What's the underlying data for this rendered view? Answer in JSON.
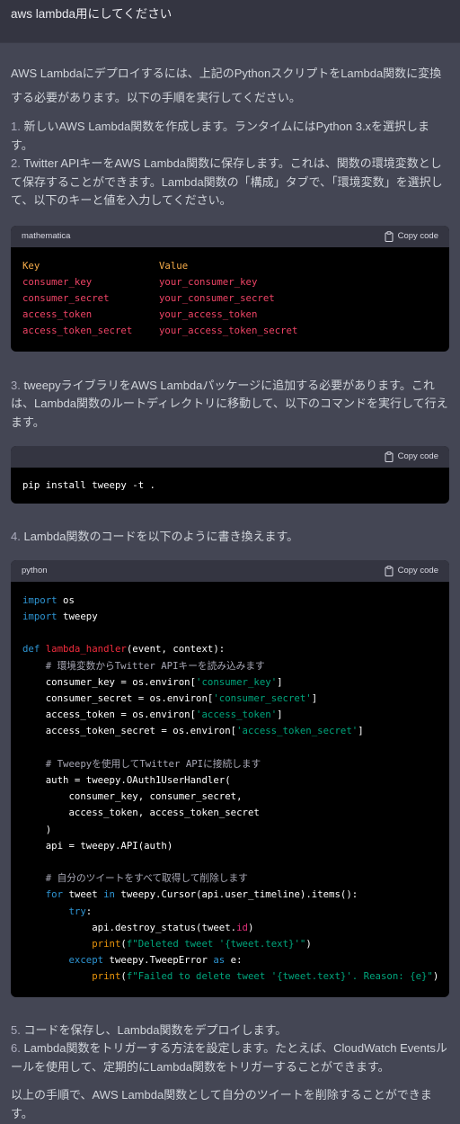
{
  "user": {
    "message": "aws lambda用にしてください"
  },
  "assistant": {
    "intro": "AWS Lambdaにデプロイするには、上記のPythonスクリプトをLambda関数に変換する必要があります。以下の手順を実行してください。",
    "steps_a": [
      {
        "num": "1.",
        "text": "新しいAWS Lambda関数を作成します。ランタイムにはPython 3.xを選択します。"
      },
      {
        "num": "2.",
        "text": "Twitter APIキーをAWS Lambda関数に保存します。これは、関数の環境変数として保存することができます。Lambda関数の「構成」タブで、「環境変数」を選択して、以下のキーと値を入力してください。"
      }
    ],
    "code1": {
      "language": "mathematica",
      "copy_label": "Copy code",
      "header": {
        "key": "Key",
        "value": "Value"
      },
      "rows": [
        {
          "key": "consumer_key",
          "value": "your_consumer_key"
        },
        {
          "key": "consumer_secret",
          "value": "your_consumer_secret"
        },
        {
          "key": "access_token",
          "value": "your_access_token"
        },
        {
          "key": "access_token_secret",
          "value": "your_access_token_secret"
        }
      ]
    },
    "step3": {
      "num": "3.",
      "text": "tweepyライブラリをAWS Lambdaパッケージに追加する必要があります。これは、Lambda関数のルートディレクトリに移動して、以下のコマンドを実行して行えます。"
    },
    "code2": {
      "copy_label": "Copy code",
      "command": "pip install tweepy -t ."
    },
    "step4": {
      "num": "4.",
      "text": "Lambda関数のコードを以下のように書き換えます。"
    },
    "code3": {
      "language": "python",
      "copy_label": "Copy code",
      "lines": [
        [
          {
            "t": "import",
            "c": "kw"
          },
          {
            "t": " os",
            "c": ""
          }
        ],
        [
          {
            "t": "import",
            "c": "kw"
          },
          {
            "t": " tweepy",
            "c": ""
          }
        ],
        [],
        [
          {
            "t": "def",
            "c": "kw"
          },
          {
            "t": " ",
            "c": ""
          },
          {
            "t": "lambda_handler",
            "c": "fn"
          },
          {
            "t": "(event, context):",
            "c": ""
          }
        ],
        [
          {
            "t": "    ",
            "c": ""
          },
          {
            "t": "# 環境変数からTwitter APIキーを読み込みます",
            "c": "cm"
          }
        ],
        [
          {
            "t": "    consumer_key = os.environ[",
            "c": ""
          },
          {
            "t": "'consumer_key'",
            "c": "str"
          },
          {
            "t": "]",
            "c": ""
          }
        ],
        [
          {
            "t": "    consumer_secret = os.environ[",
            "c": ""
          },
          {
            "t": "'consumer_secret'",
            "c": "str"
          },
          {
            "t": "]",
            "c": ""
          }
        ],
        [
          {
            "t": "    access_token = os.environ[",
            "c": ""
          },
          {
            "t": "'access_token'",
            "c": "str"
          },
          {
            "t": "]",
            "c": ""
          }
        ],
        [
          {
            "t": "    access_token_secret = os.environ[",
            "c": ""
          },
          {
            "t": "'access_token_secret'",
            "c": "str"
          },
          {
            "t": "]",
            "c": ""
          }
        ],
        [],
        [
          {
            "t": "    ",
            "c": ""
          },
          {
            "t": "# Tweepyを使用してTwitter APIに接続します",
            "c": "cm"
          }
        ],
        [
          {
            "t": "    auth = tweepy.OAuth1UserHandler(",
            "c": ""
          }
        ],
        [
          {
            "t": "        consumer_key, consumer_secret,",
            "c": ""
          }
        ],
        [
          {
            "t": "        access_token, access_token_secret",
            "c": ""
          }
        ],
        [
          {
            "t": "    )",
            "c": ""
          }
        ],
        [
          {
            "t": "    api = tweepy.API(auth)",
            "c": ""
          }
        ],
        [],
        [
          {
            "t": "    ",
            "c": ""
          },
          {
            "t": "# 自分のツイートをすべて取得して削除します",
            "c": "cm"
          }
        ],
        [
          {
            "t": "    ",
            "c": ""
          },
          {
            "t": "for",
            "c": "kw"
          },
          {
            "t": " tweet ",
            "c": ""
          },
          {
            "t": "in",
            "c": "kw"
          },
          {
            "t": " tweepy.Cursor(api.user_timeline).items():",
            "c": ""
          }
        ],
        [
          {
            "t": "        ",
            "c": ""
          },
          {
            "t": "try",
            "c": "kw"
          },
          {
            "t": ":",
            "c": ""
          }
        ],
        [
          {
            "t": "            api.destroy_status(tweet.",
            "c": ""
          },
          {
            "t": "id",
            "c": "var"
          },
          {
            "t": ")",
            "c": ""
          }
        ],
        [
          {
            "t": "            ",
            "c": ""
          },
          {
            "t": "print",
            "c": "pr"
          },
          {
            "t": "(",
            "c": ""
          },
          {
            "t": "f\"Deleted tweet '{tweet.text}'\"",
            "c": "str"
          },
          {
            "t": ")",
            "c": ""
          }
        ],
        [
          {
            "t": "        ",
            "c": ""
          },
          {
            "t": "except",
            "c": "kw"
          },
          {
            "t": " tweepy.TweepError ",
            "c": ""
          },
          {
            "t": "as",
            "c": "kw"
          },
          {
            "t": " e:",
            "c": ""
          }
        ],
        [
          {
            "t": "            ",
            "c": ""
          },
          {
            "t": "print",
            "c": "pr"
          },
          {
            "t": "(",
            "c": ""
          },
          {
            "t": "f\"Failed to delete tweet '{tweet.text}'. Reason: {e}\"",
            "c": "str"
          },
          {
            "t": ")",
            "c": ""
          }
        ]
      ]
    },
    "steps_b": [
      {
        "num": "5.",
        "text": "コードを保存し、Lambda関数をデプロイします。"
      },
      {
        "num": "6.",
        "text": "Lambda関数をトリガーする方法を設定します。たとえば、CloudWatch Eventsルールを使用して、定期的にLambda関数をトリガーすることができます。"
      }
    ],
    "closing": "以上の手順で、AWS Lambda関数として自分のツイートを削除することができます。"
  },
  "colors": {
    "page_bg": "#444654",
    "user_bg": "#343541",
    "code_bg": "#000000",
    "keyword": "#2e95d3",
    "string": "#00a67d",
    "function": "#f22c3d",
    "comment": "#a7a7b5",
    "table_header": "#f7ad4a",
    "table_value": "#ef4466"
  }
}
